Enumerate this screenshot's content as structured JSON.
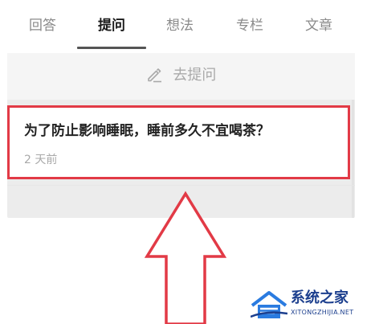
{
  "tabs": [
    {
      "label": "回答",
      "active": false
    },
    {
      "label": "提问",
      "active": true
    },
    {
      "label": "想法",
      "active": false
    },
    {
      "label": "专栏",
      "active": false
    },
    {
      "label": "文章",
      "active": false
    }
  ],
  "ask": {
    "label": "去提问",
    "icon": "pencil-icon"
  },
  "question": {
    "title": "为了防止影响睡眠，睡前多久不宜喝茶？",
    "time": "2 天前"
  },
  "highlight_color": "#e23a46",
  "watermark": {
    "name": "系统之家",
    "url": "XITONGZHIJIA.NET"
  }
}
